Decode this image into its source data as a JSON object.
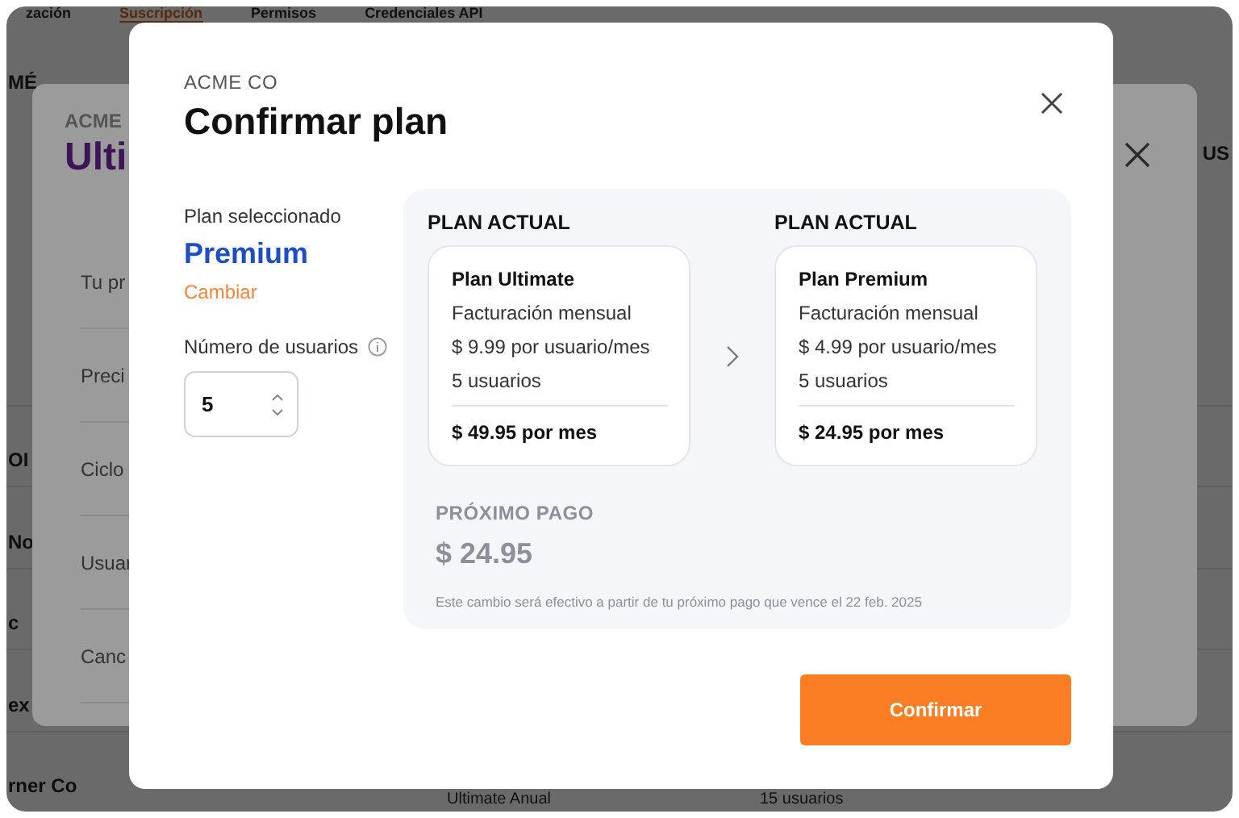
{
  "background_page": {
    "tabs": [
      {
        "label": "zación",
        "selected": false
      },
      {
        "label": "Suscripción",
        "selected": true
      },
      {
        "label": "Permisos",
        "selected": false
      },
      {
        "label": "Credenciales API",
        "selected": false
      }
    ],
    "header_left": "MÉ",
    "header_right": "US",
    "rows": [
      {
        "cells": [
          "OI"
        ]
      },
      {
        "cells": [
          "No"
        ]
      },
      {
        "cells": [
          "c"
        ]
      },
      {
        "cells": [
          "ex"
        ]
      },
      {
        "cells": [
          "rner Co",
          "Ultimate Anual",
          "15 usuarios"
        ]
      }
    ]
  },
  "background_dialog": {
    "company": "ACME",
    "title": "Ulti",
    "rows": [
      "Tu pr",
      "Preci",
      "Ciclo",
      "Usuar",
      "Canc"
    ]
  },
  "dialog": {
    "company": "ACME CO",
    "title": "Confirmar plan",
    "selected_label": "Plan seleccionado",
    "selected_plan": "Premium",
    "change_link": "Cambiar",
    "users_label": "Número de usuarios",
    "users_value": "5",
    "plans": [
      {
        "heading": "PLAN ACTUAL",
        "name": "Plan Ultimate",
        "billing": "Facturación mensual",
        "price": "$ 9.99 por usuario/mes",
        "users": "5 usuarios",
        "total": "$ 49.95 por mes"
      },
      {
        "heading": "PLAN ACTUAL",
        "name": "Plan Premium",
        "billing": "Facturación mensual",
        "price": "$ 4.99 por usuario/mes",
        "users": "5 usuarios",
        "total": "$ 24.95 por mes"
      }
    ],
    "next_payment_label": "PRÓXIMO PAGO",
    "next_payment_amount": "$ 24.95",
    "note": "Este cambio será efectivo a partir de tu próximo pago que vence el 22 feb. 2025",
    "confirm_button": "Confirmar"
  }
}
